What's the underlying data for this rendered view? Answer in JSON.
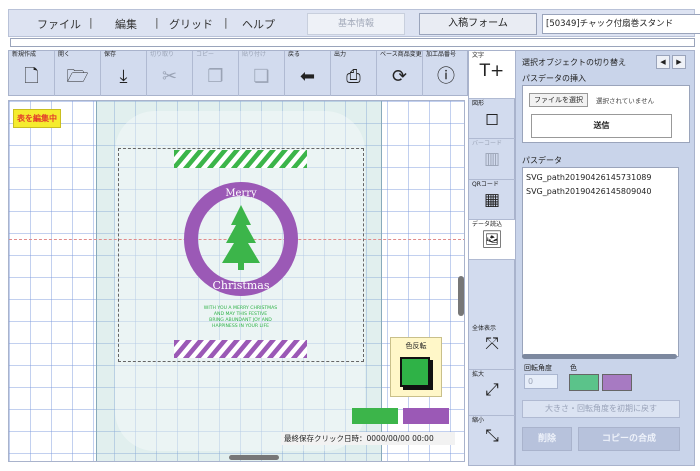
{
  "menu": {
    "items": [
      "ファイル",
      "編集",
      "グリッド",
      "ヘルプ"
    ],
    "separator": "|",
    "btn_disabled": "基本情報",
    "btn_active": "入稿フォーム",
    "document": "[50349]チャック付扇巻スタンド"
  },
  "toolbar": {
    "new": "新規作成",
    "open": "開く",
    "save": "保存",
    "cut": "切り取り",
    "copy": "コピー",
    "paste": "貼り付け",
    "back": "戻る",
    "print": "出力",
    "base": "ベース商品変更",
    "info": "加工品番号"
  },
  "sidebar": {
    "text": "文字",
    "shape": "図形",
    "barcode": "バーコード",
    "qr": "QRコード",
    "image": "データ読込",
    "fit": "全体表示",
    "zoom_in": "拡大",
    "zoom_out": "縮小"
  },
  "canvas": {
    "editing": "表を編集中",
    "invert": "色反転",
    "save_time": "最終保存クリック日時：0000/00/00 00:00",
    "design": {
      "merry": "Merry",
      "christmas": "Christmas",
      "greeting": [
        "WITH YOU A MERRY CHRISTMAS",
        "AND MAY THIS FESTIVE",
        "BRING ABUNDANT JOY AND",
        "HAPPINESS IN YOUR LIFE"
      ]
    },
    "swatch_colors": [
      "#3cb54a",
      "#9b59b6"
    ]
  },
  "panel": {
    "title": "選択オブジェクトの切り替え",
    "prev": "◀",
    "next": "▶",
    "path_insert": "パスデータの挿入",
    "file_button": "ファイルを選択",
    "no_file": "選択されていません",
    "send": "送信",
    "path_data": "パスデータ",
    "paths": [
      "SVG_path20190426145731089",
      "SVG_path20190426145809040"
    ],
    "rotation_angle": "回転角度",
    "rotation_value": "0",
    "color": "色",
    "colors": [
      "#5bc38a",
      "#a77ac2"
    ],
    "reset": "大きさ・回転角度を初期に戻す",
    "delete": "削除",
    "copy_compose": "コピーの合成"
  }
}
